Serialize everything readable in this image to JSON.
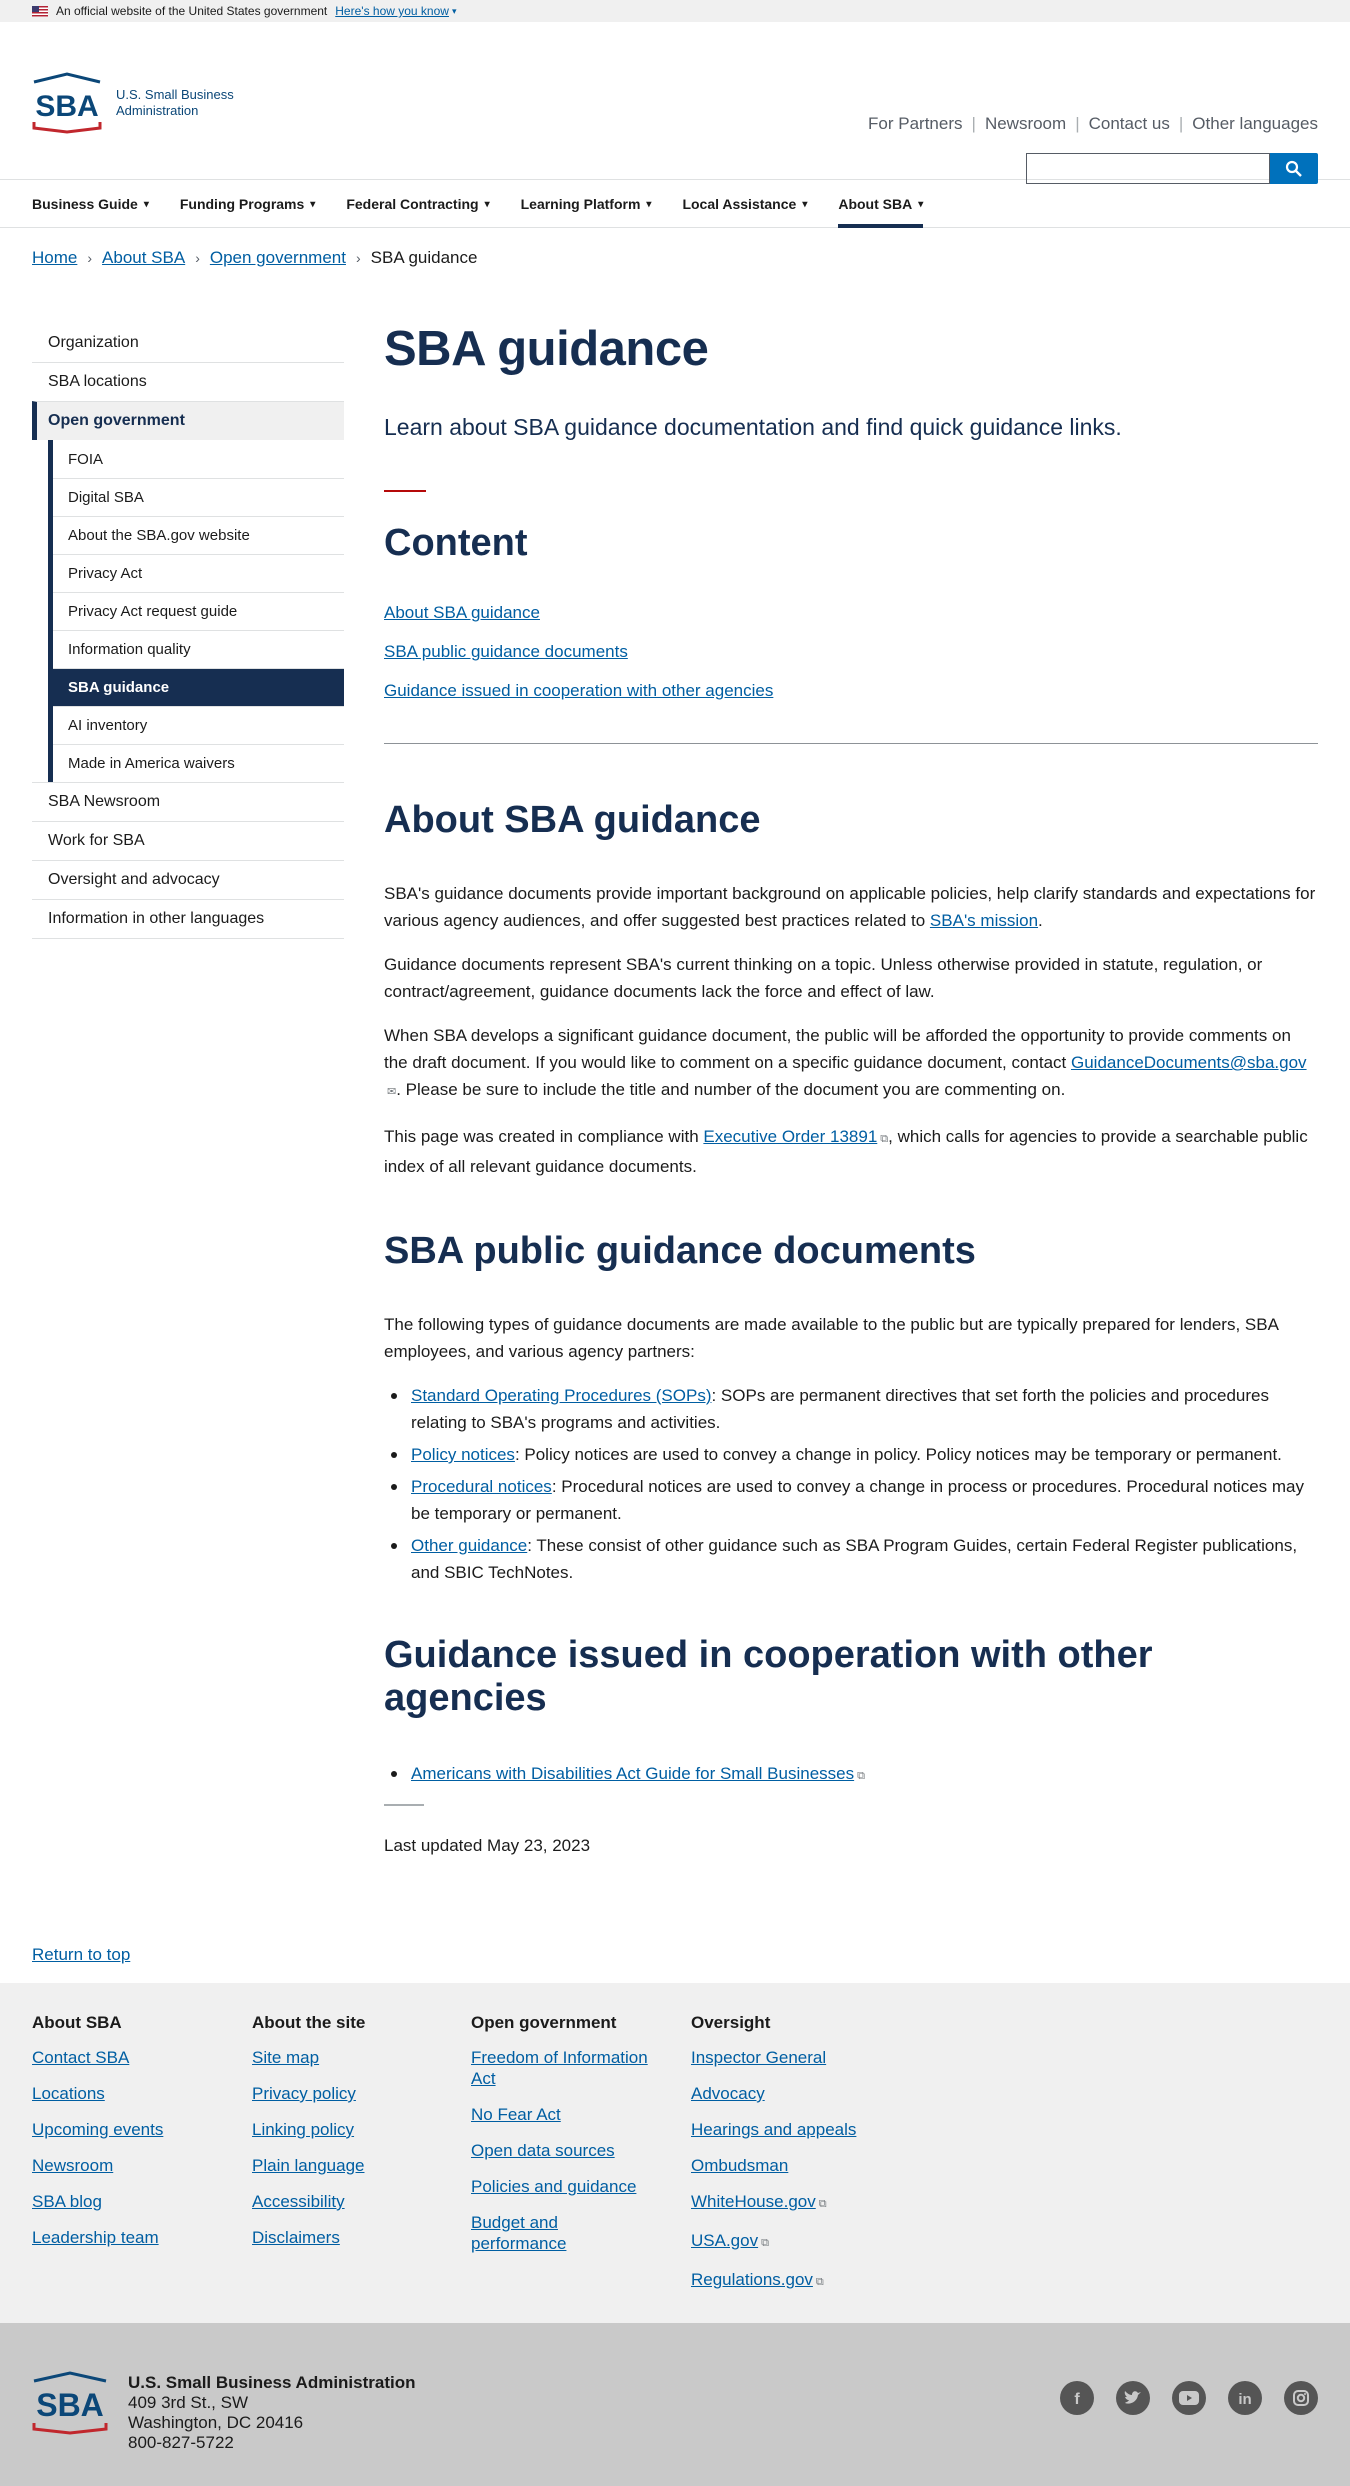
{
  "gov_banner": {
    "text": "An official website of the United States government",
    "link": "Here's how you know"
  },
  "header": {
    "logo_text": "SBA",
    "agency_line1": "U.S. Small Business",
    "agency_line2": "Administration",
    "top_links": [
      "For Partners",
      "Newsroom",
      "Contact us",
      "Other languages"
    ],
    "search_placeholder": ""
  },
  "main_nav": [
    {
      "label": "Business Guide"
    },
    {
      "label": "Funding Programs"
    },
    {
      "label": "Federal Contracting"
    },
    {
      "label": "Learning Platform"
    },
    {
      "label": "Local Assistance"
    },
    {
      "label": "About SBA",
      "active": true
    }
  ],
  "breadcrumb": {
    "items": [
      "Home",
      "About SBA",
      "Open government"
    ],
    "current": "SBA guidance"
  },
  "sidenav": {
    "items_top": [
      "Organization",
      "SBA locations",
      "Open government"
    ],
    "sub_items": [
      "FOIA",
      "Digital SBA",
      "About the SBA.gov website",
      "Privacy Act",
      "Privacy Act request guide",
      "Information quality",
      "SBA guidance",
      "AI inventory",
      "Made in America waivers"
    ],
    "items_bottom": [
      "SBA Newsroom",
      "Work for SBA",
      "Oversight and advocacy",
      "Information in other languages"
    ]
  },
  "main": {
    "title": "SBA guidance",
    "lead": "Learn about SBA guidance documentation and find quick guidance links.",
    "content_heading": "Content",
    "toc": [
      "About SBA guidance",
      "SBA public guidance documents",
      "Guidance issued in cooperation with other agencies"
    ],
    "about": {
      "heading": "About SBA guidance",
      "p1_text": "SBA's guidance documents provide important background on applicable policies, help clarify standards and expectations for various agency audiences, and offer suggested best practices related to ",
      "p1_link": "SBA's mission",
      "p1_end": ".",
      "p2": "Guidance documents represent SBA's current thinking on a topic. Unless otherwise provided in statute, regulation, or contract/agreement, guidance documents lack the force and effect of law.",
      "p3_text": "When SBA develops a significant guidance document, the public will be afforded the opportunity to provide comments on the draft document. If you would like to comment on a specific guidance document, contact ",
      "p3_link": "GuidanceDocuments@sba.gov",
      "p3_end": ". Please be sure to include the title and number of the document you are commenting on.",
      "p4_text": "This page was created in compliance with ",
      "p4_link": "Executive Order 13891",
      "p4_end": ", which calls for agencies to provide a searchable public index of all relevant guidance documents."
    },
    "public_docs": {
      "heading": "SBA public guidance documents",
      "intro": "The following types of guidance documents are made available to the public but are typically prepared for lenders, SBA employees, and various agency partners:",
      "bullets": [
        {
          "link": "Standard Operating Procedures (SOPs)",
          "text": ": SOPs are permanent directives that set forth the policies and procedures relating to SBA's programs and activities."
        },
        {
          "link": "Policy notices",
          "text": ": Policy notices are used to convey a change in policy. Policy notices may be temporary or permanent."
        },
        {
          "link": "Procedural notices",
          "text": ": Procedural notices are used to convey a change in process or procedures. Procedural notices may be temporary or permanent."
        },
        {
          "link": "Other guidance",
          "text": ": These consist of other guidance such as SBA Program Guides, certain Federal Register publications, and SBIC TechNotes."
        }
      ]
    },
    "cooperation": {
      "heading": "Guidance issued in cooperation with other agencies",
      "link": "Americans with Disabilities Act Guide for Small Businesses"
    },
    "last_updated": "Last updated May 23, 2023"
  },
  "return_to_top": "Return to top",
  "footer": {
    "columns": [
      {
        "heading": "About SBA",
        "links": [
          "Contact SBA",
          "Locations",
          "Upcoming events",
          "Newsroom",
          "SBA blog",
          "Leadership team"
        ]
      },
      {
        "heading": "About the site",
        "links": [
          "Site map",
          "Privacy policy",
          "Linking policy",
          "Plain language",
          "Accessibility",
          "Disclaimers"
        ]
      },
      {
        "heading": "Open government",
        "links": [
          "Freedom of Information Act",
          "No Fear Act",
          "Open data sources",
          "Policies and guidance",
          "Budget and performance"
        ]
      },
      {
        "heading": "Oversight",
        "links": [
          "Inspector General",
          "Advocacy",
          "Hearings and appeals",
          "Ombudsman",
          "WhiteHouse.gov",
          "USA.gov",
          "Regulations.gov"
        ]
      }
    ],
    "address": {
      "org": "U.S. Small Business Administration",
      "line1": "409 3rd St., SW",
      "line2": "Washington, DC 20416",
      "phone": "800-827-5722"
    },
    "social_icons": [
      "facebook-icon",
      "twitter-icon",
      "youtube-icon",
      "linkedin-icon",
      "instagram-icon"
    ]
  },
  "colors": {
    "navy": "#162e51",
    "link": "#005ea2",
    "accent_red": "#b50909",
    "search_blue": "#0071bc"
  }
}
